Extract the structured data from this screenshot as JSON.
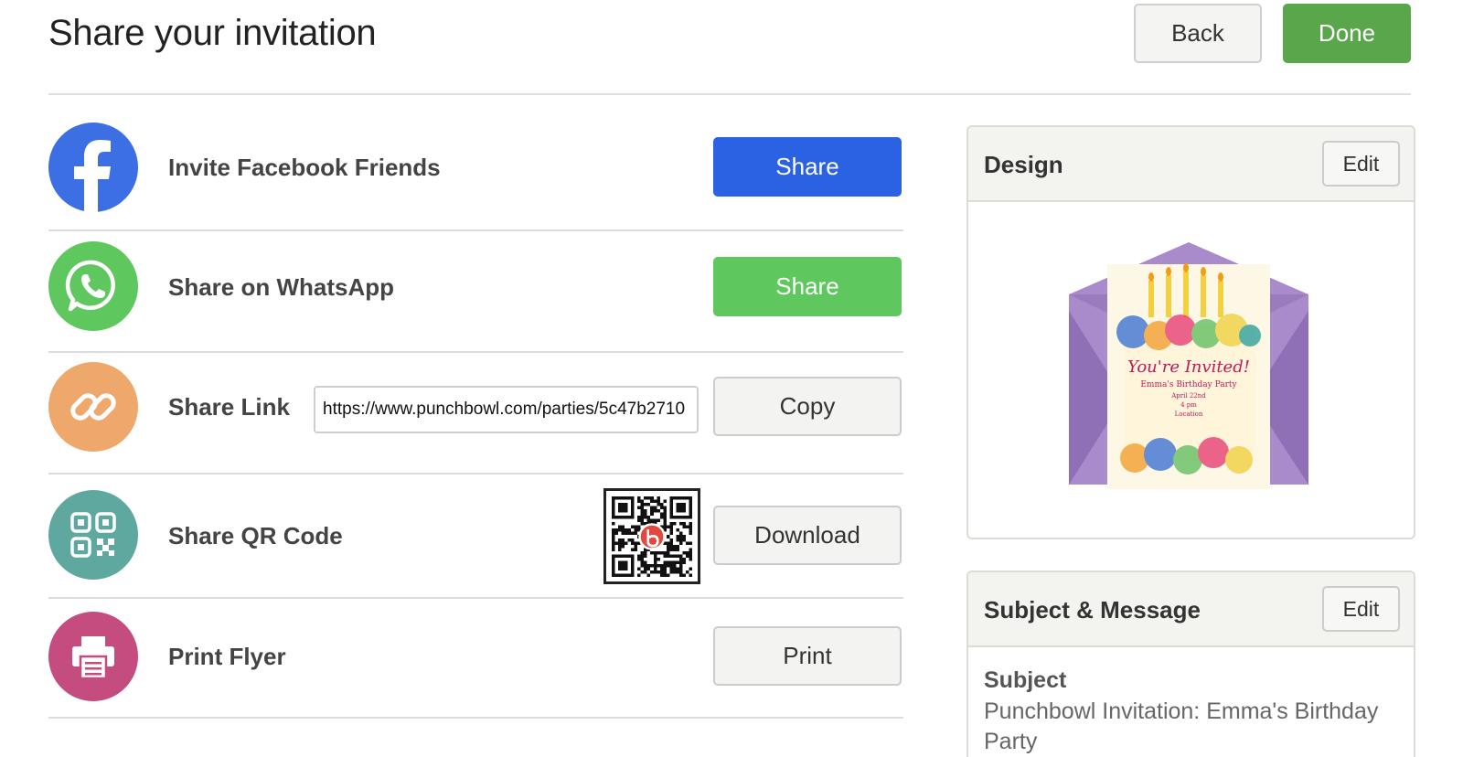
{
  "header": {
    "title": "Share your invitation",
    "back_label": "Back",
    "done_label": "Done"
  },
  "share_rows": [
    {
      "label": "Invite Facebook Friends",
      "button": "Share",
      "icon": "facebook-icon",
      "color": "#3b6fe3"
    },
    {
      "label": "Share on WhatsApp",
      "button": "Share",
      "icon": "whatsapp-icon",
      "color": "#5ec85e"
    },
    {
      "label": "Share Link",
      "button": "Copy",
      "icon": "link-icon",
      "color": "#eea86c",
      "link_value": "https://www.punchbowl.com/parties/5c47b2710"
    },
    {
      "label": "Share QR Code",
      "button": "Download",
      "icon": "qr-code-icon",
      "color": "#5fa8a0"
    },
    {
      "label": "Print Flyer",
      "button": "Print",
      "icon": "printer-icon",
      "color": "#c44c7f"
    }
  ],
  "design_card": {
    "title": "Design",
    "edit_label": "Edit",
    "invitation_text": {
      "headline": "You're Invited!",
      "line1": "Emma's Birthday Party",
      "line2": "April 22nd",
      "line3": "4 pm",
      "line4": "Location"
    }
  },
  "message_card": {
    "title": "Subject & Message",
    "edit_label": "Edit",
    "subject_label": "Subject",
    "subject_value": "Punchbowl Invitation: Emma's Birthday Party"
  },
  "colors": {
    "facebook": "#2b62e3",
    "whatsapp": "#5ec85e",
    "done": "#5aa64a",
    "link": "#eea86c",
    "qr": "#5fa8a0",
    "print": "#c44c7f"
  }
}
